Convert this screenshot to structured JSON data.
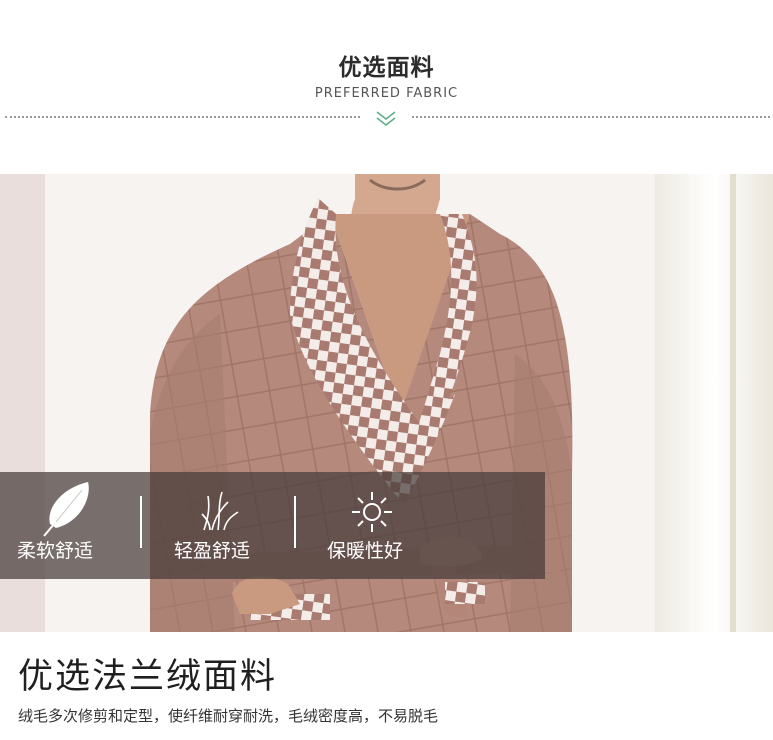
{
  "header": {
    "title_cn": "优选面料",
    "title_en": "PREFERRED FABRIC",
    "chevron_icon": "double-chevron-down-icon",
    "accent_color": "#5fae8a"
  },
  "features": [
    {
      "label": "柔软舒适",
      "icon": "feather-icon"
    },
    {
      "label": "轻盈舒适",
      "icon": "grass-icon"
    },
    {
      "label": "保暖性好",
      "icon": "sun-icon"
    }
  ],
  "fabric": {
    "title": "优选法兰绒面料",
    "description": "绒毛多次修剪和定型，使纤维耐穿耐洗，毛绒密度高，不易脱毛"
  },
  "colors": {
    "robe": "#b58a7d",
    "robe_shadow": "#9d7267",
    "check_light": "#f4ece8",
    "check_dark": "#a97b70",
    "overlay": "#463c3a"
  }
}
